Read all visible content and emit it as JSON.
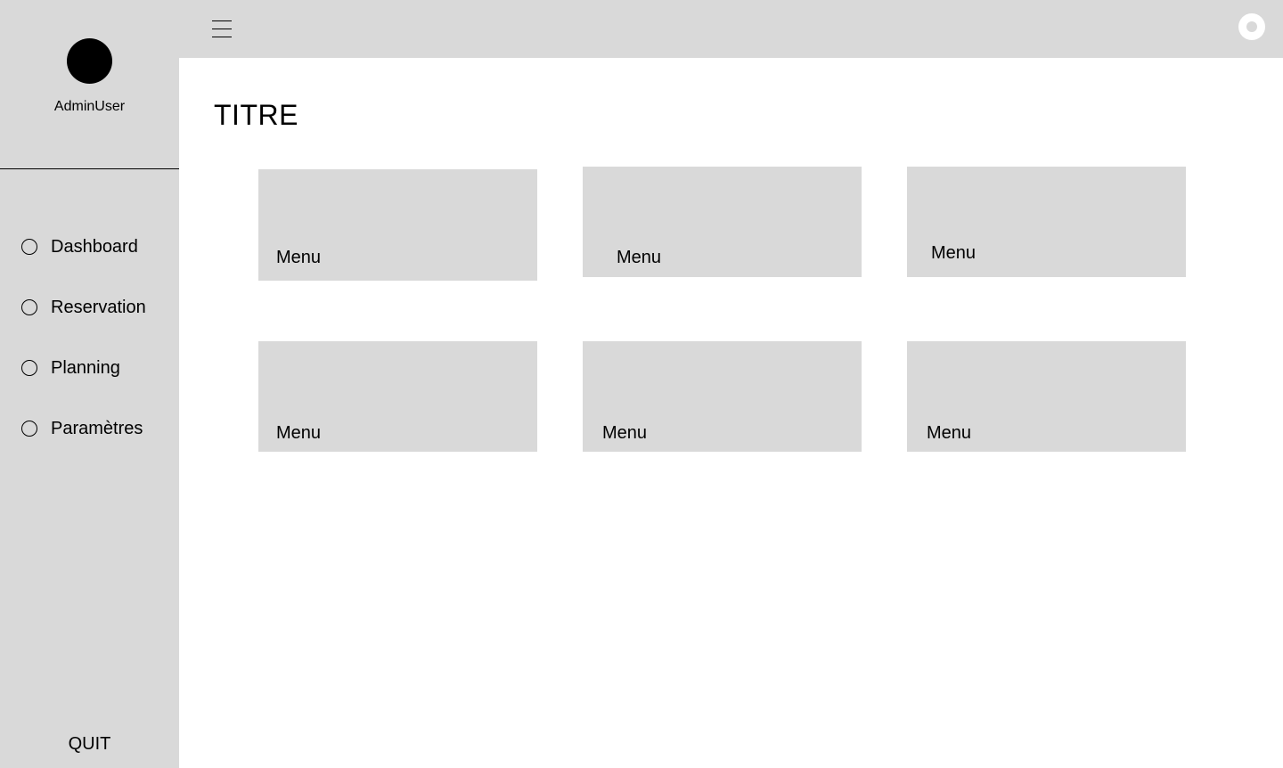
{
  "sidebar": {
    "username": "AdminUser",
    "items": [
      {
        "label": "Dashboard"
      },
      {
        "label": "Reservation"
      },
      {
        "label": "Planning"
      },
      {
        "label": "Paramètres"
      }
    ],
    "quit_label": "QUIT"
  },
  "main": {
    "title": "TITRE",
    "cards": [
      {
        "label": "Menu"
      },
      {
        "label": "Menu"
      },
      {
        "label": "Menu"
      },
      {
        "label": "Menu"
      },
      {
        "label": "Menu"
      },
      {
        "label": "Menu"
      }
    ]
  },
  "colors": {
    "panel": "#d9d9d9",
    "background": "#ffffff",
    "text": "#000000"
  },
  "icons": {
    "menu": "hamburger-menu-icon",
    "toggle": "toggle-icon",
    "nav": "radio-circle-icon"
  }
}
